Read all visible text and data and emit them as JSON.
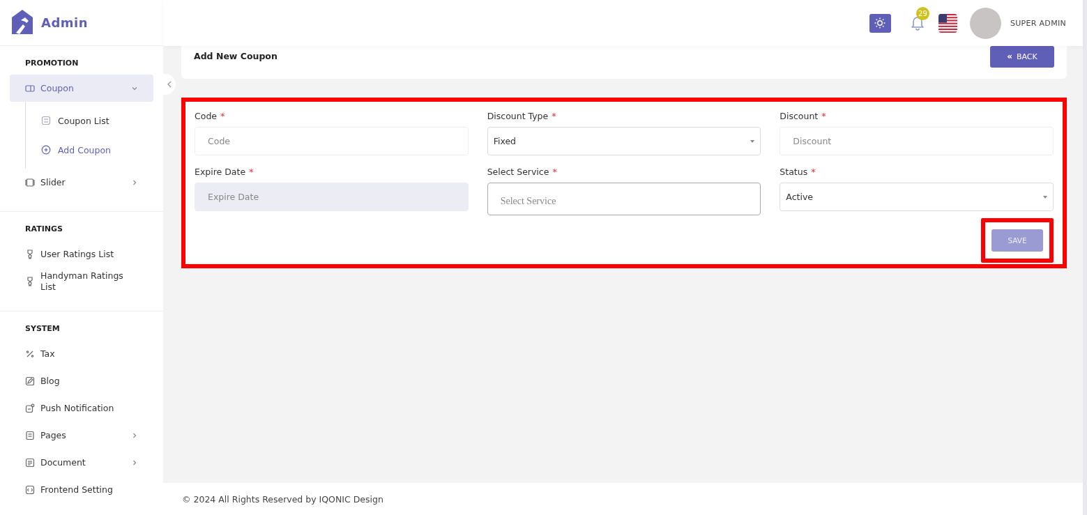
{
  "brand": {
    "name": "Admin"
  },
  "sidebar": {
    "sections": [
      {
        "title": "PROMOTION",
        "items": [
          {
            "label": "Coupon",
            "selected": true,
            "expanded": true,
            "children": [
              {
                "label": "Coupon List",
                "selected": false
              },
              {
                "label": "Add Coupon",
                "selected": true
              }
            ]
          },
          {
            "label": "Slider",
            "selected": false,
            "expanded": false
          }
        ]
      },
      {
        "title": "RATINGS",
        "items": [
          {
            "label": "User Ratings List",
            "selected": false
          },
          {
            "label": "Handyman Ratings List",
            "selected": false
          }
        ]
      },
      {
        "title": "SYSTEM",
        "items": [
          {
            "label": "Tax",
            "selected": false
          },
          {
            "label": "Blog",
            "selected": false
          },
          {
            "label": "Push Notification",
            "selected": false
          },
          {
            "label": "Pages",
            "selected": false,
            "expanded": false
          },
          {
            "label": "Document",
            "selected": false,
            "expanded": false
          },
          {
            "label": "Frontend Setting",
            "selected": false
          }
        ]
      }
    ]
  },
  "header": {
    "notification_count": "29",
    "user_name": "SUPER ADMIN"
  },
  "page_title": "Add New Coupon",
  "back_button": {
    "icon": "«",
    "label": "BACK"
  },
  "form": {
    "highlighted": true,
    "fields": [
      {
        "kind": "input",
        "label": "Code",
        "required_mark": "*",
        "placeholder": "Code"
      },
      {
        "kind": "select",
        "label": "Discount Type",
        "required_mark": "*",
        "value": "Fixed"
      },
      {
        "kind": "input",
        "label": "Discount",
        "required_mark": "*",
        "placeholder": "Discount"
      },
      {
        "kind": "date",
        "label": "Expire Date",
        "required_mark": "*",
        "placeholder": "Expire Date"
      },
      {
        "kind": "multiselect",
        "label": "Select Service",
        "required_mark": "*",
        "placeholder": "Select Service"
      },
      {
        "kind": "select",
        "label": "Status",
        "required_mark": "*",
        "value": "Active"
      }
    ],
    "save_button": {
      "label": "SAVE",
      "disabled": true,
      "highlighted": true
    }
  },
  "footer": "© 2024 All Rights Reserved by IQONIC Design"
}
